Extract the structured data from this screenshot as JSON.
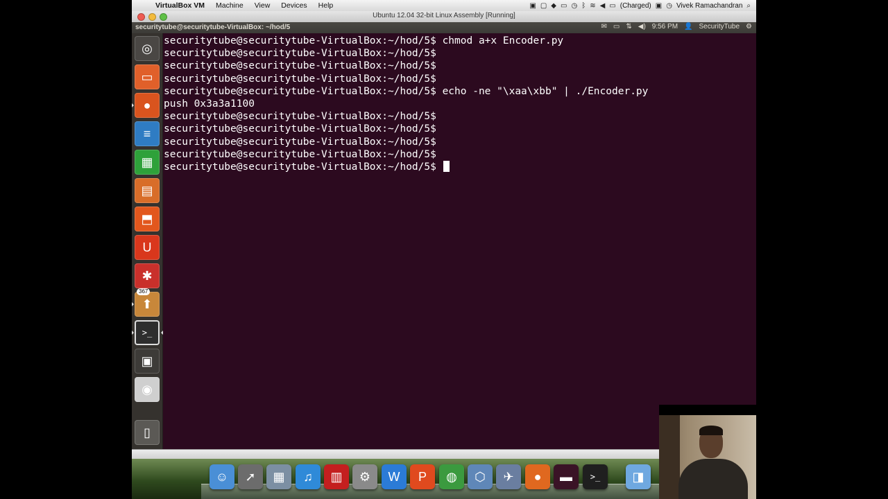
{
  "mac_menubar": {
    "apple_icon": "apple-icon",
    "app_name": "VirtualBox VM",
    "menus": [
      "Machine",
      "View",
      "Devices",
      "Help"
    ],
    "battery_status": "(Charged)",
    "user_name": "Vivek Ramachandran"
  },
  "vbox_window": {
    "title": "Ubuntu 12.04 32-bit Linux Assembly [Running]"
  },
  "ubuntu_panel": {
    "window_title": "securitytube@securitytube-VirtualBox: ~/hod/5",
    "time": "9:56 PM",
    "user": "SecurityTube"
  },
  "launcher": {
    "items": [
      {
        "name": "dash-home-icon",
        "glyph": "◎",
        "color": "#4a4744"
      },
      {
        "name": "home-folder-icon",
        "glyph": "▭",
        "color": "#e0602a"
      },
      {
        "name": "firefox-icon",
        "glyph": "●",
        "color": "#d9541e"
      },
      {
        "name": "libreoffice-writer-icon",
        "glyph": "≡",
        "color": "#2f7cc3"
      },
      {
        "name": "libreoffice-calc-icon",
        "glyph": "▦",
        "color": "#2ea13a"
      },
      {
        "name": "libreoffice-impress-icon",
        "glyph": "▤",
        "color": "#d86d29"
      },
      {
        "name": "ubuntu-software-center-icon",
        "glyph": "⬒",
        "color": "#e2571d"
      },
      {
        "name": "ubuntu-one-icon",
        "glyph": "U",
        "color": "#d9371c"
      },
      {
        "name": "system-settings-icon",
        "glyph": "✱",
        "color": "#c9302b"
      },
      {
        "name": "update-manager-icon",
        "glyph": "⬆",
        "color": "#c8873a",
        "badge": "367"
      },
      {
        "name": "terminal-icon",
        "glyph": ">_",
        "color": "#2e2e2e"
      },
      {
        "name": "workspace-switcher-icon",
        "glyph": "▣",
        "color": "#3d3b38"
      },
      {
        "name": "dvd-icon",
        "glyph": "◉",
        "color": "#cfcfcf"
      },
      {
        "name": "trash-icon",
        "glyph": "▯",
        "color": "#5b5955"
      }
    ]
  },
  "terminal": {
    "lines": [
      "securitytube@securitytube-VirtualBox:~/hod/5$ chmod a+x Encoder.py",
      "securitytube@securitytube-VirtualBox:~/hod/5$ ",
      "securitytube@securitytube-VirtualBox:~/hod/5$ ",
      "securitytube@securitytube-VirtualBox:~/hod/5$ ",
      "securitytube@securitytube-VirtualBox:~/hod/5$ echo -ne \"\\xaa\\xbb\" | ./Encoder.py",
      "push 0x3a3a1100",
      "securitytube@securitytube-VirtualBox:~/hod/5$ ",
      "securitytube@securitytube-VirtualBox:~/hod/5$ ",
      "securitytube@securitytube-VirtualBox:~/hod/5$ ",
      "securitytube@securitytube-VirtualBox:~/hod/5$ "
    ],
    "current_prompt": "securitytube@securitytube-VirtualBox:~/hod/5$ "
  },
  "dock": {
    "items": [
      {
        "name": "finder-icon",
        "glyph": "☺",
        "color": "#4a8fd6"
      },
      {
        "name": "launchpad-icon",
        "glyph": "➚",
        "color": "#6c6c6c"
      },
      {
        "name": "preview-icon",
        "glyph": "▦",
        "color": "#7c8fa3"
      },
      {
        "name": "itunes-icon",
        "glyph": "♫",
        "color": "#2f8ad8"
      },
      {
        "name": "photo-booth-icon",
        "glyph": "▥",
        "color": "#c41f1f"
      },
      {
        "name": "system-preferences-icon",
        "glyph": "⚙",
        "color": "#8a8a8a"
      },
      {
        "name": "word-icon",
        "glyph": "W",
        "color": "#2b7bd6"
      },
      {
        "name": "powerpoint-icon",
        "glyph": "P",
        "color": "#e04a1e"
      },
      {
        "name": "chrome-icon",
        "glyph": "◍",
        "color": "#3b9a3f"
      },
      {
        "name": "virtualbox-icon",
        "glyph": "⬡",
        "color": "#5f87b8"
      },
      {
        "name": "photo-app-icon",
        "glyph": "✈",
        "color": "#6a7ea0"
      },
      {
        "name": "firefox-dock-icon",
        "glyph": "●",
        "color": "#e0681f"
      },
      {
        "name": "vm-preview-icon",
        "glyph": "▬",
        "color": "#3a1326"
      },
      {
        "name": "terminal-dock-icon",
        "glyph": ">_",
        "color": "#1f1f1f"
      },
      {
        "name": "applications-folder-icon",
        "glyph": "◨",
        "color": "#6fa8e0"
      }
    ]
  }
}
